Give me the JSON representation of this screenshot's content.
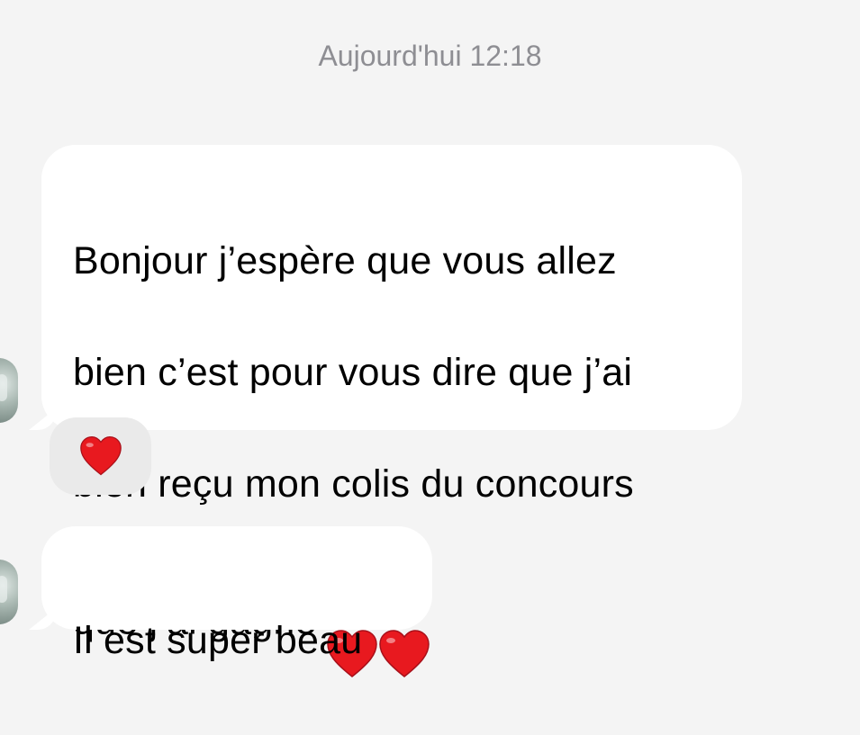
{
  "conversation": {
    "timestamp": "Aujourd'hui 12:18",
    "messages": [
      {
        "lines": [
          "Bonjour j’espère que vous allez",
          "bien c’est pour vous dire que j’ai",
          "bien reçu mon colis du concours",
          "que j’ai gagné"
        ],
        "trailing_emoji": "red-heart-x2",
        "reaction": "red-heart"
      },
      {
        "lines": [
          "Il est super beau"
        ]
      }
    ]
  },
  "colors": {
    "background": "#f4f4f4",
    "bubble": "#ffffff",
    "timestamp_text": "#8e8e93",
    "reaction_bg": "#eaeaea",
    "heart": "#e8191f"
  }
}
